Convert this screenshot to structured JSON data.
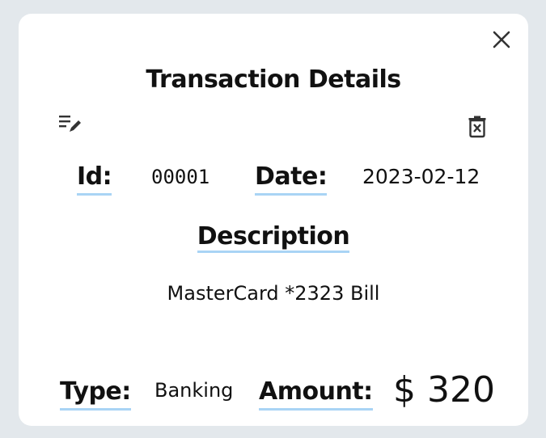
{
  "dialog": {
    "title": "Transaction Details",
    "close_icon": "close-icon",
    "edit_icon": "edit-list-icon",
    "delete_icon": "trash-icon"
  },
  "fields": {
    "id_label": "Id:",
    "id_value": "00001",
    "date_label": "Date:",
    "date_value": "2023-02-12",
    "description_label": "Description",
    "description_value": "MasterCard *2323 Bill",
    "type_label": "Type:",
    "type_value": "Banking",
    "amount_label": "Amount:",
    "amount_value": "$ 320"
  },
  "colors": {
    "background": "#e3e8ec",
    "card": "#ffffff",
    "label_underline": "#a9d4f5",
    "text": "#111111"
  }
}
